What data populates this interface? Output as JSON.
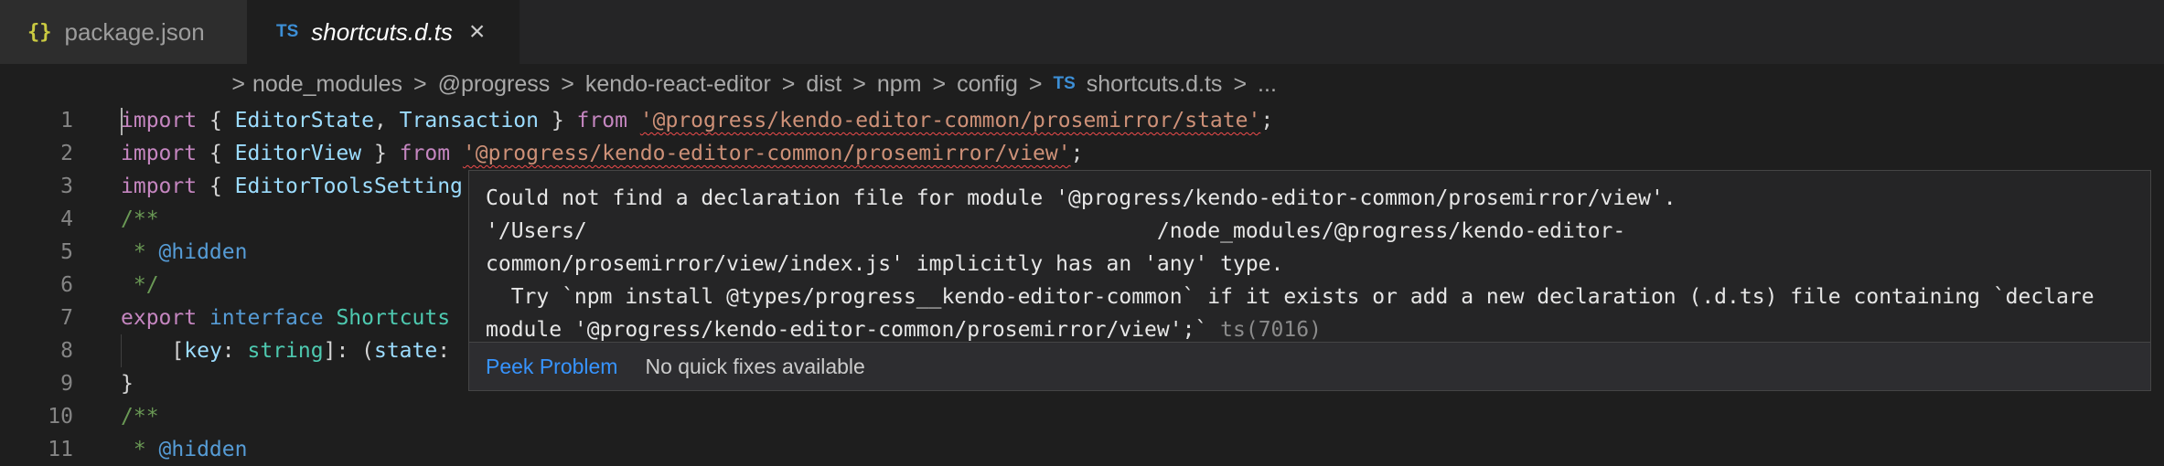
{
  "tabs": [
    {
      "icon": "json-icon",
      "icon_text": "{}",
      "label": "package.json",
      "active": false
    },
    {
      "icon": "ts-icon",
      "icon_text": "TS",
      "label": "shortcuts.d.ts",
      "active": true,
      "close": "×"
    }
  ],
  "breadcrumb": {
    "separator": ">",
    "items": [
      "node_modules",
      "@progress",
      "kendo-react-editor",
      "dist",
      "npm",
      "config"
    ],
    "file_icon_text": "TS",
    "file": "shortcuts.d.ts",
    "trailing": "..."
  },
  "editor": {
    "line_numbers": [
      "1",
      "2",
      "3",
      "4",
      "5",
      "6",
      "7",
      "8",
      "9",
      "10",
      "11"
    ],
    "line1": {
      "kw_import": "import",
      "open": " { ",
      "t1": "EditorState",
      "comma": ", ",
      "t2": "Transaction",
      "close": " } ",
      "kw_from": "from",
      "sp": " ",
      "str": "'@progress/kendo-editor-common/prosemirror/state'",
      "end": ";"
    },
    "line2": {
      "kw_import": "import",
      "open": " { ",
      "t1": "EditorView",
      "close": " } ",
      "kw_from": "from",
      "sp": " ",
      "str": "'@progress/kendo-editor-common/prosemirror/view'",
      "end": ";"
    },
    "line3": {
      "kw_import": "import",
      "open": " { ",
      "t1": "EditorToolsSetting"
    },
    "line4": "/**",
    "line5": {
      "star": " * ",
      "tag": "@hidden"
    },
    "line6": " */",
    "line7": {
      "kw_export": "export",
      "sp": " ",
      "kw_interface": "interface",
      "sp2": " ",
      "name": "Shortcuts"
    },
    "line8": {
      "indent": "    [",
      "key": "key",
      "colon": ": ",
      "type": "string",
      "rest": "]: (",
      "state": "state",
      "end": ":"
    },
    "line9": "}",
    "line10": "/**",
    "line11": {
      "star": " * ",
      "tag": "@hidden"
    }
  },
  "hover": {
    "lines": [
      "Could not find a declaration file for module '@progress/kendo-editor-common/prosemirror/view'.",
      "'/Users/                                             /node_modules/@progress/kendo-editor-",
      "common/prosemirror/view/index.js' implicitly has an 'any' type.",
      "  Try `npm install @types/progress__kendo-editor-common` if it exists or add a new declaration (.d.ts) file containing `declare",
      "module '@progress/kendo-editor-common/prosemirror/view';`"
    ],
    "error_code": "ts(7016)",
    "peek_label": "Peek Problem",
    "no_fix_label": "No quick fixes available"
  }
}
